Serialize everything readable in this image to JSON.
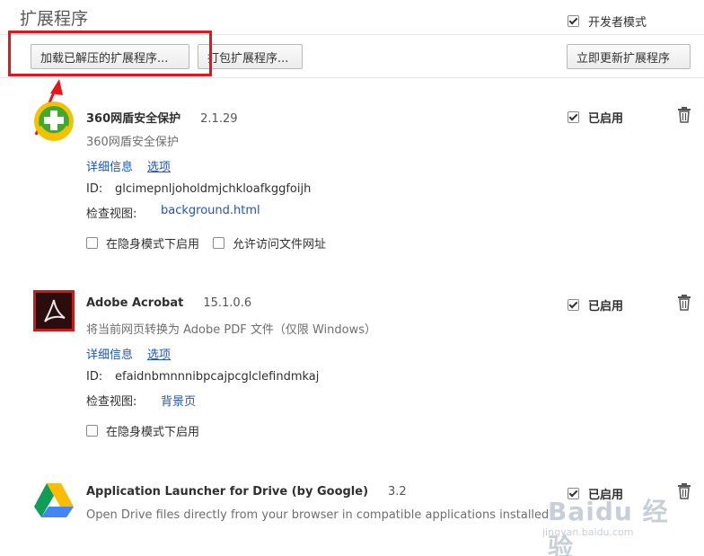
{
  "header": {
    "title": "扩展程序",
    "developer_mode_label": "开发者模式",
    "developer_mode_checked": true
  },
  "toolbar": {
    "load_unpacked_label": "加载已解压的扩展程序...",
    "pack_label": "打包扩展程序...",
    "update_label": "立即更新扩展程序",
    "highlight_color": "#e8141a"
  },
  "extensions": [
    {
      "name": "360网盾安全保护",
      "version": "2.1.29",
      "description": "360网盾安全保护",
      "details_link": "详细信息",
      "options_link": "选项",
      "id_label": "ID:",
      "id": "glcimepnljoholdmjchkloafkggfoijh",
      "inspect_label": "检查视图:",
      "inspect_link": "background.html",
      "options": [
        "在隐身模式下启用",
        "允许访问文件网址"
      ],
      "enabled_label": "已启用",
      "icon": "360-shield-icon"
    },
    {
      "name": "Adobe Acrobat",
      "version": "15.1.0.6",
      "description": "将当前网页转换为 Adobe PDF 文件（仅限 Windows）",
      "details_link": "详细信息",
      "options_link": "选项",
      "id_label": "ID:",
      "id": "efaidnbmnnnibpcajpcglclefindmkaj",
      "inspect_label": "检查视图:",
      "inspect_link": "背景页",
      "options": [
        "在隐身模式下启用"
      ],
      "enabled_label": "已启用",
      "icon": "adobe-acrobat-icon"
    },
    {
      "name": "Application Launcher for Drive (by Google)",
      "version": "3.2",
      "description": "Open Drive files directly from your browser in compatible applications installed on",
      "enabled_label": "已启用",
      "icon": "google-drive-icon"
    }
  ],
  "watermark": {
    "text": "Baidu 经验",
    "subtext": "jingyan.baidu.com"
  }
}
